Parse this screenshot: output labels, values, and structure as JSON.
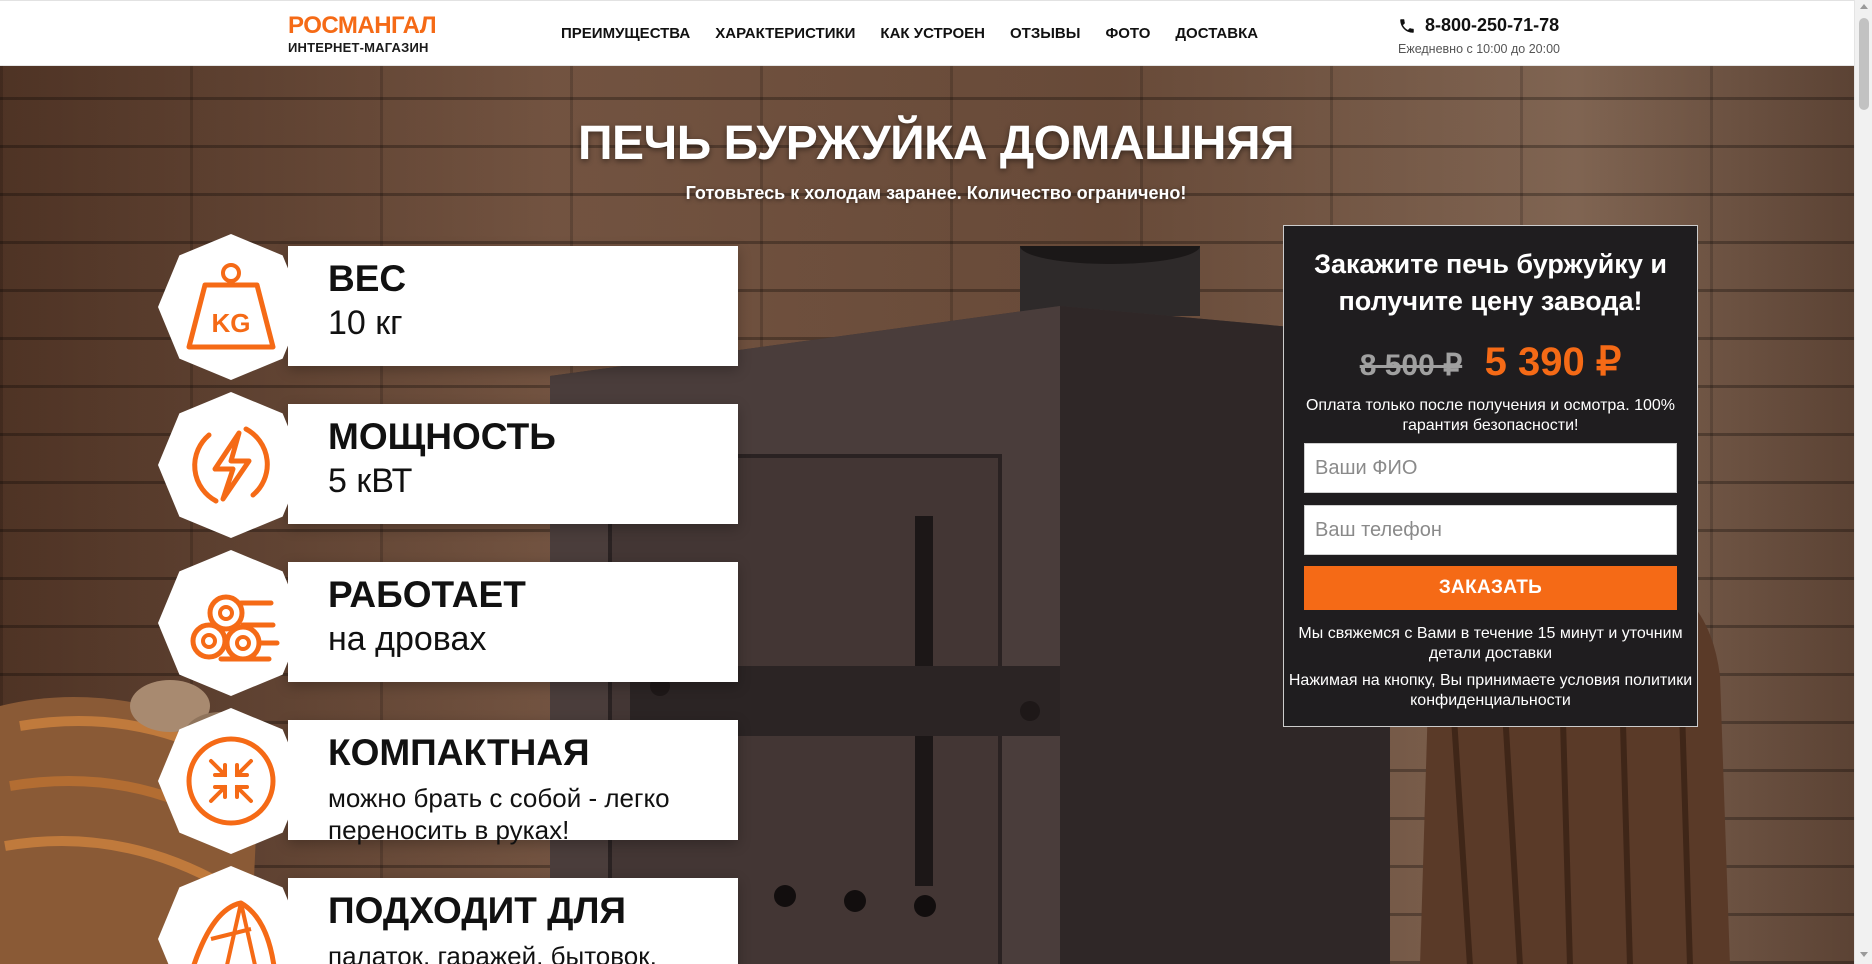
{
  "header": {
    "logo_title": "РОСМАНГАЛ",
    "logo_subtitle": "ИНТЕРНЕТ-МАГАЗИН",
    "nav": [
      "ПРЕИМУЩЕСТВА",
      "ХАРАКТЕРИСТИКИ",
      "КАК УСТРОЕН",
      "ОТЗЫВЫ",
      "ФОТО",
      "ДОСТАВКА"
    ],
    "phone": "8-800-250-71-78",
    "hours": "Ежедневно с 10:00 до 20:00",
    "phone_icon": "phone-icon"
  },
  "hero": {
    "title": "ПЕЧЬ БУРЖУЙКА ДОМАШНЯЯ",
    "subtitle": "Готовьтесь к холодам заранее. Количество ограничено!"
  },
  "features": [
    {
      "icon": "weight-kg-icon",
      "icon_text": "KG",
      "title": "ВЕС",
      "text": "10 кг"
    },
    {
      "icon": "lightning-icon",
      "title": "МОЩНОСТЬ",
      "text": "5 кВТ"
    },
    {
      "icon": "firewood-icon",
      "title": "РАБОТАЕТ",
      "text": "на дровах"
    },
    {
      "icon": "compress-arrows-icon",
      "title": "КОМПАКТНАЯ",
      "text": "можно брать с собой - легко переносить в руках!"
    },
    {
      "icon": "tent-icon",
      "title": "ПОДХОДИТ ДЛЯ",
      "text": "палаток, гаражей, бытовок,"
    }
  ],
  "order": {
    "title": "Закажите печь буржуйку и получите цену завода!",
    "old_price": "8 500 ₽",
    "new_price": "5 390 ₽",
    "guarantee": "Оплата только после получения и осмотра. 100% гарантия безопасности!",
    "name_placeholder": "Ваши ФИО",
    "phone_placeholder": "Ваш телефон",
    "button_label": "ЗАКАЗАТЬ",
    "callback_note": "Мы свяжемся с Вами в течение 15 минут и уточним детали доставки",
    "privacy_note": "Нажимая на кнопку, Вы принимаете условия политики конфиденциальности"
  },
  "colors": {
    "accent": "#f56a16",
    "form_bg": "#1f1d1f",
    "text_dark": "#111111"
  }
}
